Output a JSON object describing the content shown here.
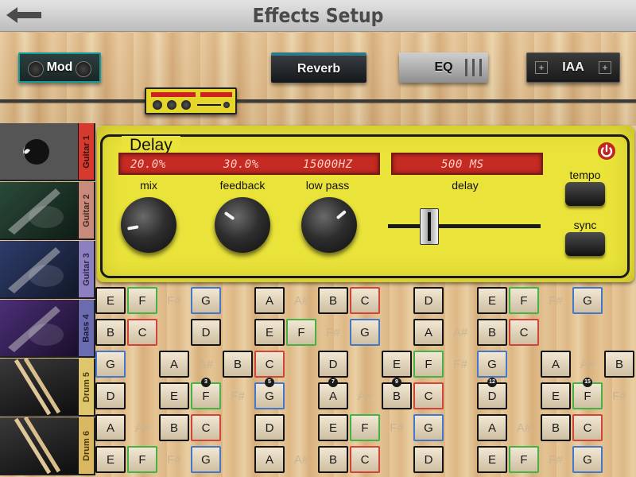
{
  "header": {
    "title": "Effects Setup"
  },
  "effects": {
    "mod": "Mod",
    "reverb": "Reverb",
    "eq": "EQ",
    "iaa": "IAA"
  },
  "tracks": [
    {
      "label": "Guitar 1",
      "tab_color": "#d63a2f",
      "text_color": "#3b1010",
      "thumb": "acoustic-guitar"
    },
    {
      "label": "Guitar 2",
      "tab_color": "#c88a7a",
      "text_color": "#4a2a22",
      "thumb": "electric-guitar-green"
    },
    {
      "label": "Guitar 3",
      "tab_color": "#8d80c0",
      "text_color": "#2e2a50",
      "thumb": "electric-guitar-blue"
    },
    {
      "label": "Bass 4",
      "tab_color": "#6b6bb0",
      "text_color": "#1c1c40",
      "thumb": "bass-guitar-purple"
    },
    {
      "label": "Drum 5",
      "tab_color": "#ddc66b",
      "text_color": "#4d3c06",
      "thumb": "drumsticks"
    },
    {
      "label": "Drum 6",
      "tab_color": "#d9b861",
      "text_color": "#4d3c06",
      "thumb": "drumsticks"
    }
  ],
  "delay": {
    "title": "Delay",
    "mix_value": "20.0%",
    "feedback_value": "30.0%",
    "lowpass_value": "15000HZ",
    "delay_value": "500 MS",
    "mix_label": "mix",
    "feedback_label": "feedback",
    "lowpass_label": "low pass",
    "delay_label": "delay",
    "tempo_label": "tempo",
    "sync_label": "sync",
    "mix_fraction": 0.2,
    "feedback_fraction": 0.3,
    "delay_fraction": 0.25
  },
  "fretboard": {
    "strings": [
      [
        "E",
        "F",
        "F#",
        "G",
        "",
        "A",
        "A#",
        "B",
        "C",
        "",
        "D",
        "",
        "E",
        "F",
        "F#",
        "G"
      ],
      [
        "B",
        "C",
        "",
        "D",
        "",
        "E",
        "F",
        "F#",
        "G",
        "",
        "A",
        "A#",
        "B",
        "C",
        "",
        ""
      ],
      [
        "G",
        "",
        "A",
        "A#",
        "B",
        "C",
        "",
        "D",
        "",
        "E",
        "F",
        "F#",
        "G",
        "",
        "A",
        "A#",
        "B"
      ],
      [
        "D",
        "",
        "E",
        "F",
        "F#",
        "G",
        "",
        "A",
        "A#",
        "B",
        "C",
        "",
        "D",
        "",
        "E",
        "F",
        "F#"
      ],
      [
        "A",
        "A#",
        "B",
        "C",
        "",
        "D",
        "",
        "E",
        "F",
        "F#",
        "G",
        "",
        "A",
        "A#",
        "B",
        "C"
      ],
      [
        "E",
        "F",
        "F#",
        "G",
        "",
        "A",
        "A#",
        "B",
        "C",
        "",
        "D",
        "",
        "E",
        "F",
        "F#",
        "G"
      ]
    ],
    "fret_markers": [
      "3",
      "5",
      "7",
      "9",
      "12",
      "15"
    ]
  }
}
